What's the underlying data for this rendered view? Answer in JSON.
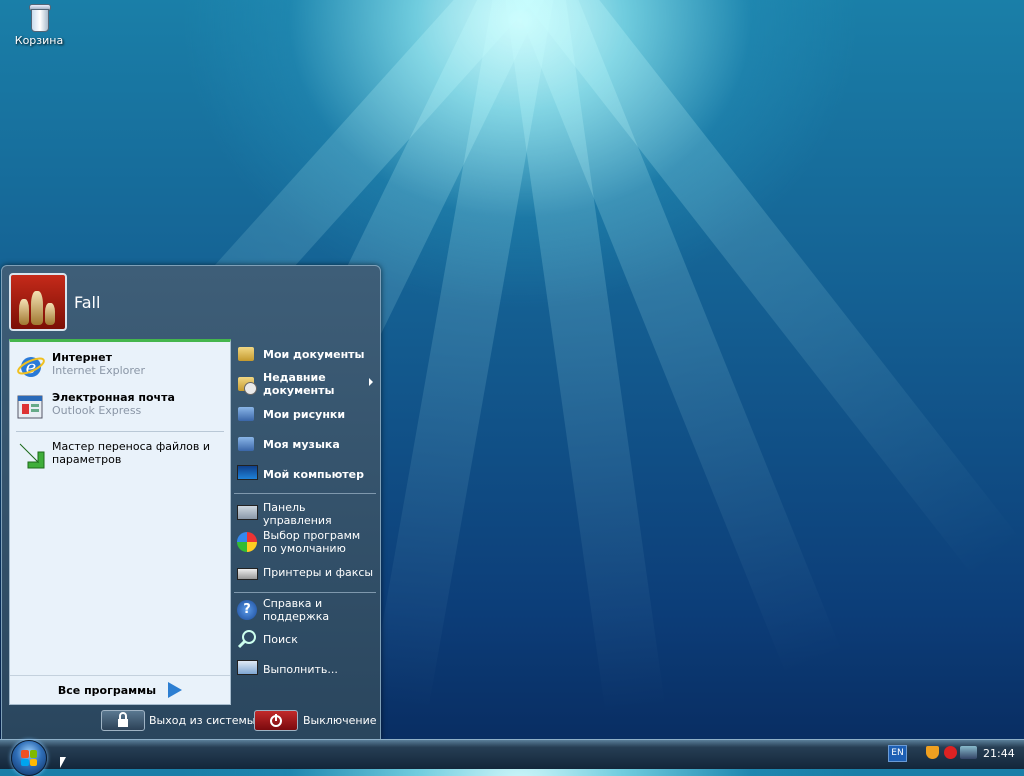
{
  "desktop": {
    "icons": [
      {
        "label": "Корзина",
        "icon": "recycle-bin-icon"
      }
    ]
  },
  "start_menu": {
    "user": {
      "name": "Fall",
      "avatar": "chess-pieces-avatar"
    },
    "pinned": [
      {
        "title": "Интернет",
        "subtitle": "Internet Explorer",
        "icon": "internet-explorer-icon"
      },
      {
        "title": "Электронная почта",
        "subtitle": "Outlook Express",
        "icon": "outlook-express-icon"
      }
    ],
    "recent": [
      {
        "title": "Мастер переноса файлов и параметров",
        "icon": "transfer-wizard-icon"
      }
    ],
    "all_programs": "Все программы",
    "right": {
      "my_documents": "Мои документы",
      "recent_documents": "Недавние документы",
      "my_pictures": "Мои рисунки",
      "my_music": "Моя музыка",
      "my_computer": "Мой компьютер",
      "control_panel": "Панель управления",
      "default_programs": "Выбор программ по умолчанию",
      "printers": "Принтеры и факсы",
      "help": "Справка и поддержка",
      "search": "Поиск",
      "run": "Выполнить..."
    },
    "log_off": "Выход из системы",
    "shut_down": "Выключение"
  },
  "taskbar": {
    "language": "EN",
    "clock": "21:44"
  },
  "colors": {
    "accent_green": "#45b64d",
    "shutdown_red": "#a0151a",
    "menu_dark": "#2a465e"
  }
}
